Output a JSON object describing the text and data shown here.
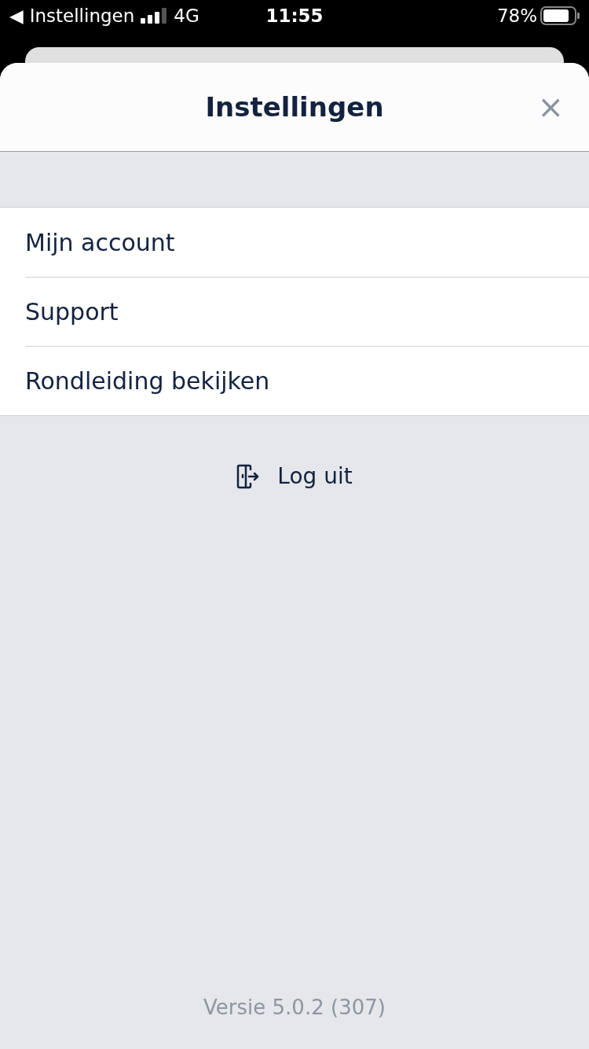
{
  "status_bar": {
    "back_glyph": "◀",
    "back_label": "Instellingen",
    "network": "4G",
    "time": "11:55",
    "battery": "78%"
  },
  "sheet": {
    "title": "Instellingen",
    "close_glyph": "×"
  },
  "menu": [
    {
      "label": "Mijn account"
    },
    {
      "label": "Support"
    },
    {
      "label": "Rondleiding bekijken"
    }
  ],
  "logout": {
    "label": "Log uit"
  },
  "version": "Versie 5.0.2 (307)"
}
